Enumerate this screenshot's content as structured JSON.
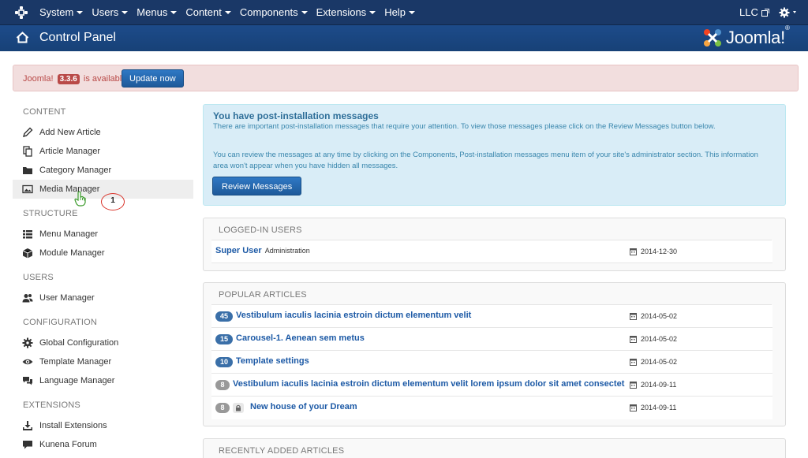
{
  "navbar": {
    "menus": [
      "System",
      "Users",
      "Menus",
      "Content",
      "Components",
      "Extensions",
      "Help"
    ],
    "site_link": "LLC"
  },
  "header": {
    "title": "Control Panel",
    "brand": "Joomla!",
    "brand_reg": "®"
  },
  "update_alert": {
    "prefix": "Joomla!",
    "version": "3.3.6",
    "suffix": "is available:",
    "button": "Update now"
  },
  "sidebar": {
    "sections": [
      {
        "heading": "CONTENT",
        "items": [
          {
            "label": "Add New Article",
            "icon": "pencil-icon"
          },
          {
            "label": "Article Manager",
            "icon": "copy-icon"
          },
          {
            "label": "Category Manager",
            "icon": "folder-icon"
          },
          {
            "label": "Media Manager",
            "icon": "image-icon"
          }
        ]
      },
      {
        "heading": "STRUCTURE",
        "items": [
          {
            "label": "Menu Manager",
            "icon": "list-icon"
          },
          {
            "label": "Module Manager",
            "icon": "cube-icon"
          }
        ]
      },
      {
        "heading": "USERS",
        "items": [
          {
            "label": "User Manager",
            "icon": "users-icon"
          }
        ]
      },
      {
        "heading": "CONFIGURATION",
        "items": [
          {
            "label": "Global Configuration",
            "icon": "gear-icon"
          },
          {
            "label": "Template Manager",
            "icon": "eye-icon"
          },
          {
            "label": "Language Manager",
            "icon": "comments-icon"
          }
        ]
      },
      {
        "heading": "EXTENSIONS",
        "items": [
          {
            "label": "Install Extensions",
            "icon": "download-icon"
          },
          {
            "label": "Kunena Forum",
            "icon": "comment-icon"
          }
        ]
      }
    ]
  },
  "postinstall": {
    "title": "You have post-installation messages",
    "para1": "There are important post-installation messages that require your attention. To view those messages please click on the Review Messages button below.",
    "para2": "You can review the messages at any time by clicking on the Components, Post-installation messages menu item of your site's administrator section. This information area won't appear when you have hidden all messages.",
    "button": "Review Messages"
  },
  "logged_in": {
    "heading": "LOGGED-IN USERS",
    "rows": [
      {
        "name": "Super User",
        "area": "Administration",
        "date": "2014-12-30"
      }
    ]
  },
  "popular": {
    "heading": "POPULAR ARTICLES",
    "rows": [
      {
        "hits": "45",
        "title": "Vestibulum iaculis lacinia estroin dictum elementum velit",
        "date": "2014-05-02",
        "locked": false
      },
      {
        "hits": "15",
        "title": "Carousel-1. Aenean sem metus",
        "date": "2014-05-02",
        "locked": false
      },
      {
        "hits": "10",
        "title": "Template settings",
        "date": "2014-05-02",
        "locked": false
      },
      {
        "hits": "8",
        "title": "Vestibulum iaculis lacinia estroin dictum elementum velit lorem ipsum dolor sit amet consectet",
        "date": "2014-09-11",
        "locked": false
      },
      {
        "hits": "8",
        "title": "New house of your Dream",
        "date": "2014-09-11",
        "locked": true
      }
    ]
  },
  "recent": {
    "heading": "RECENTLY ADDED ARTICLES"
  },
  "annotation": {
    "number": "1"
  },
  "colors": {
    "navbar": "#1a3867",
    "header": "#1d4b8a",
    "link": "#1d5aa6",
    "alert_bg": "#f2dede",
    "info_bg": "#d9edf7"
  }
}
